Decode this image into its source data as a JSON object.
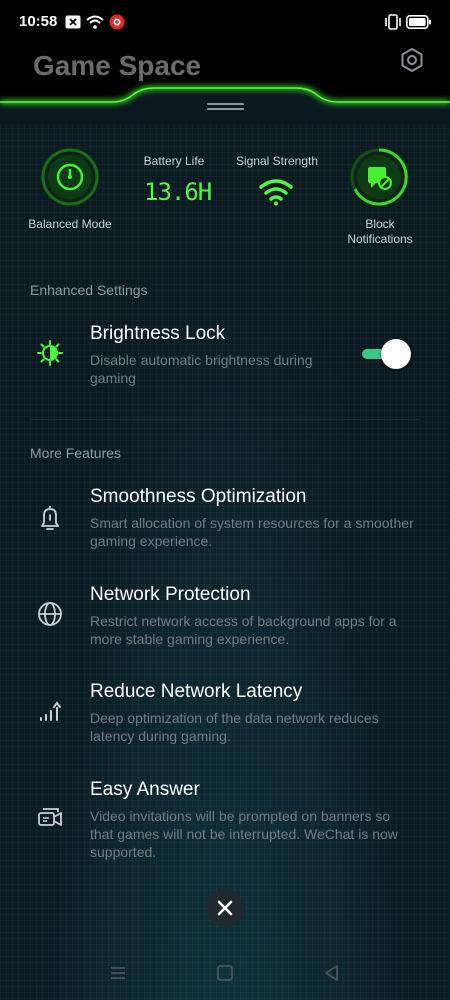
{
  "status_bar": {
    "time": "10:58",
    "icons": [
      "notification-box-icon",
      "wifi-icon",
      "app-notification-icon",
      "vibrate-icon",
      "battery-icon"
    ]
  },
  "header": {
    "title": "Game Space",
    "settings_icon": "gear-icon",
    "accent_color": "#39e820"
  },
  "quick_stats": {
    "mode_label": "Balanced Mode",
    "battery_label": "Battery Life",
    "battery_value": "13.6H",
    "signal_label": "Signal Strength",
    "block_label_line1": "Block",
    "block_label_line2": "Notifications"
  },
  "enhanced": {
    "section_title": "Enhanced Settings",
    "brightness": {
      "title": "Brightness Lock",
      "desc": "Disable automatic brightness during gaming",
      "toggle_on": true,
      "toggle_color": "#39c98a"
    }
  },
  "more": {
    "section_title": "More Features",
    "items": [
      {
        "icon": "bell-icon",
        "title": "Smoothness Optimization",
        "desc": "Smart allocation of system resources for a smoother gaming experience."
      },
      {
        "icon": "globe-icon",
        "title": "Network Protection",
        "desc": "Restrict network access of background apps for a more stable gaming experience."
      },
      {
        "icon": "signal-bars-icon",
        "title": "Reduce Network Latency",
        "desc": "Deep optimization of the data network reduces latency during gaming."
      },
      {
        "icon": "video-call-icon",
        "title": "Easy Answer",
        "desc": "Video invitations will be prompted on banners so that games will not be interrupted. WeChat is now supported."
      }
    ]
  },
  "nav": {
    "icons": [
      "menu-icon",
      "home-square-icon",
      "back-triangle-icon",
      "close-icon"
    ]
  }
}
